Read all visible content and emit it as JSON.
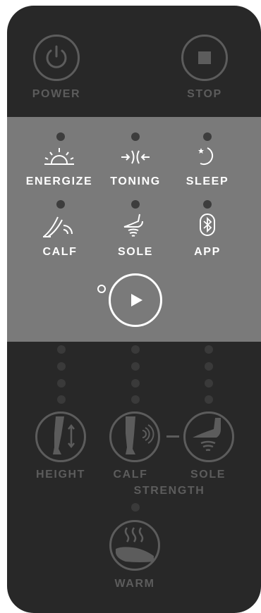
{
  "top": {
    "power_label": "POWER",
    "stop_label": "STOP"
  },
  "modes": [
    {
      "label": "ENERGIZE",
      "icon": "sunrise-icon"
    },
    {
      "label": "TONING",
      "icon": "toning-icon"
    },
    {
      "label": "SLEEP",
      "icon": "moon-star-icon"
    },
    {
      "label": "CALF",
      "icon": "calf-icon"
    },
    {
      "label": "SOLE",
      "icon": "sole-icon"
    },
    {
      "label": "APP",
      "icon": "bluetooth-icon"
    }
  ],
  "bottom": {
    "height_label": "HEIGHT",
    "calf_label": "CALF",
    "sole_label": "SOLE",
    "strength_label": "STRENGTH",
    "warm_label": "WARM"
  },
  "colors": {
    "body": "#282828",
    "mode_panel": "#7a7a7a",
    "dim_gray": "#5c5c5c",
    "indicator_dot": "#3a3a3a",
    "active_white": "#ffffff"
  }
}
